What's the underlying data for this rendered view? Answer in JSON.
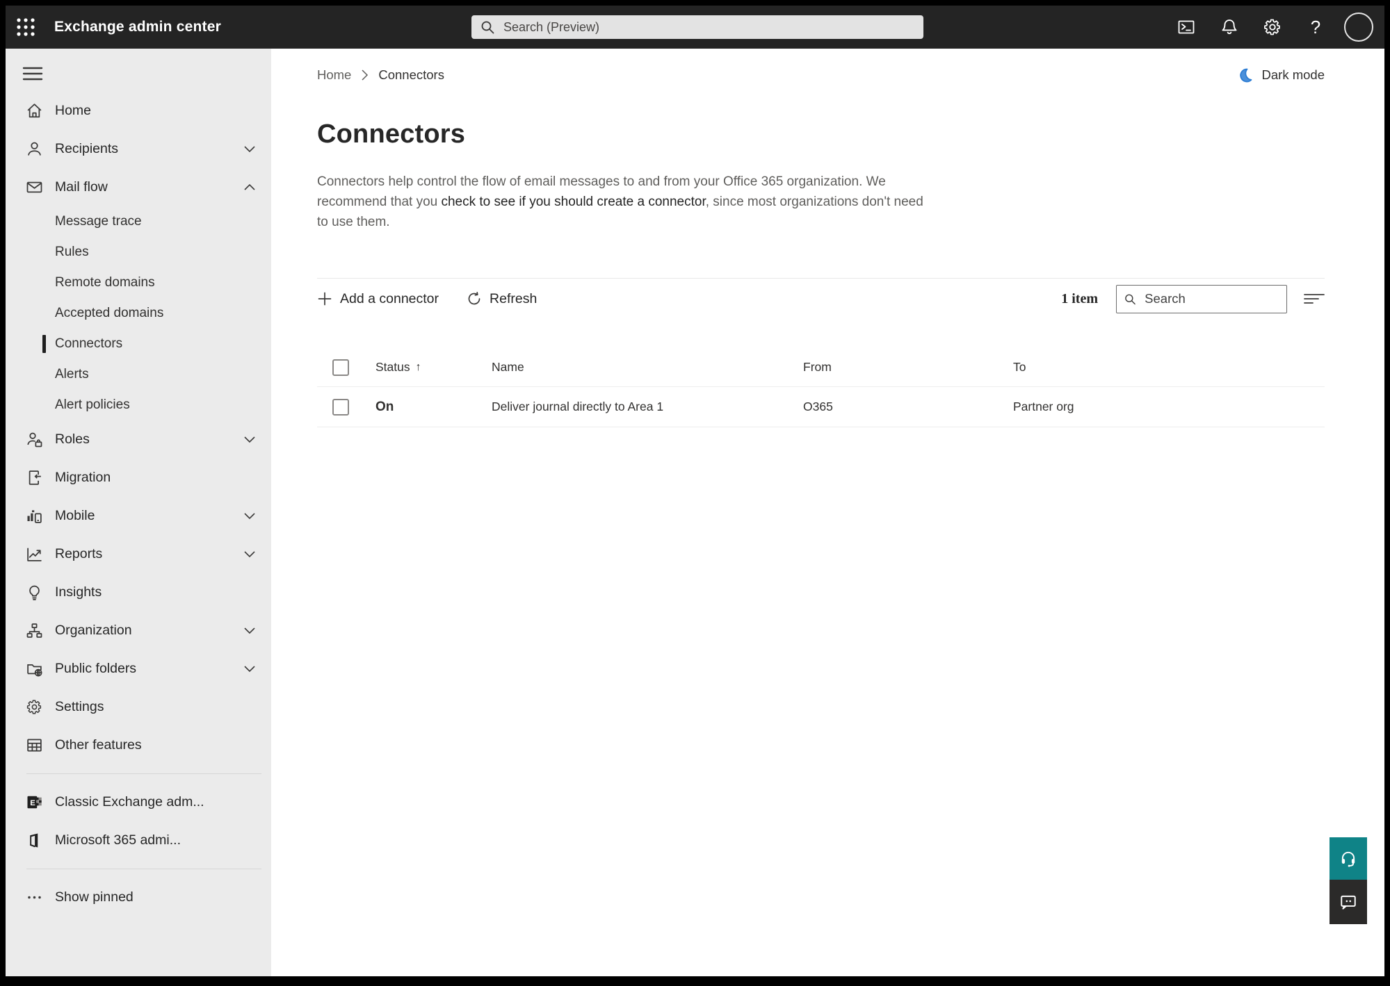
{
  "topbar": {
    "title": "Exchange admin center",
    "search_placeholder": "Search (Preview)",
    "icons": [
      "app-launcher-icon",
      "terminal-icon",
      "bell-icon",
      "gear-icon",
      "help-icon",
      "avatar"
    ],
    "help_glyph": "?"
  },
  "sidebar": {
    "items": {
      "home": {
        "label": "Home"
      },
      "recipients": {
        "label": "Recipients"
      },
      "mailflow": {
        "label": "Mail flow"
      },
      "roles": {
        "label": "Roles"
      },
      "migration": {
        "label": "Migration"
      },
      "mobile": {
        "label": "Mobile"
      },
      "reports": {
        "label": "Reports"
      },
      "insights": {
        "label": "Insights"
      },
      "organization": {
        "label": "Organization"
      },
      "public_folders": {
        "label": "Public folders"
      },
      "settings": {
        "label": "Settings"
      },
      "other_features": {
        "label": "Other features"
      }
    },
    "mailflow_children": [
      "Message trace",
      "Rules",
      "Remote domains",
      "Accepted domains",
      "Connectors",
      "Alerts",
      "Alert policies"
    ],
    "selected_child": "Connectors",
    "classic_exchange": "Classic Exchange adm...",
    "m365_admin": "Microsoft 365 admi...",
    "show_pinned": "Show pinned"
  },
  "breadcrumb": {
    "home": "Home",
    "current": "Connectors"
  },
  "dark_mode_label": "Dark mode",
  "page": {
    "title": "Connectors",
    "description": {
      "part1": "Connectors help control the flow of email messages to and from your Office 365 organization. We recommend that you ",
      "link": "check to see if you should create a connector",
      "part2": ", since most organizations don't need to use them."
    }
  },
  "toolbar": {
    "add_label": "Add a connector",
    "refresh_label": "Refresh",
    "item_count": "1 item",
    "search_placeholder": "Search"
  },
  "table": {
    "columns": {
      "status": "Status",
      "name": "Name",
      "from": "From",
      "to": "To"
    },
    "sort_arrow": "↑",
    "rows": [
      {
        "status": "On",
        "name": "Deliver journal directly to Area 1",
        "from": "O365",
        "to": "Partner org"
      }
    ]
  },
  "colors": {
    "topbar_bg": "#242424",
    "sidebar_bg": "#ebebeb",
    "accent_teal": "#0f8387",
    "moon_blue": "#2b7cd3",
    "selected_marker": "#1f1f1f"
  }
}
